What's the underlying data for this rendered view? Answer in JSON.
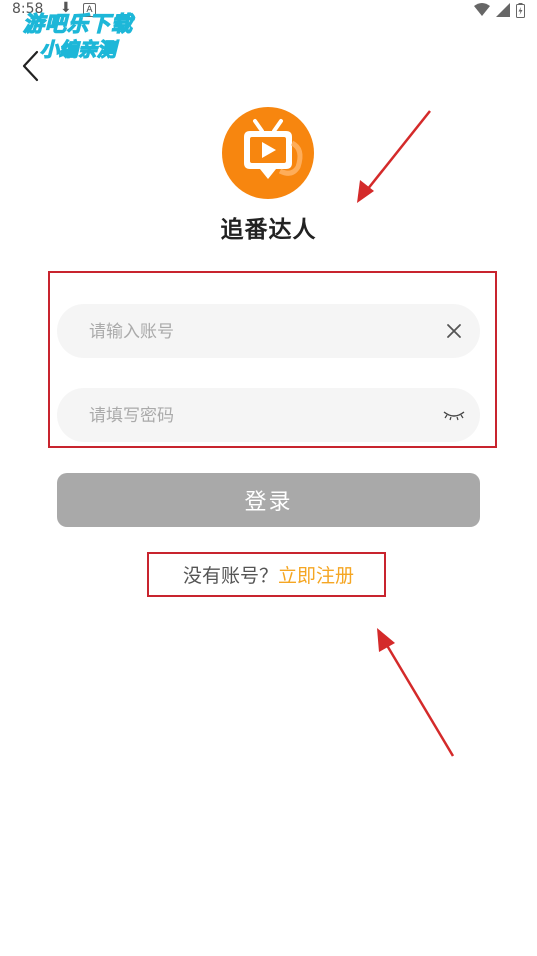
{
  "status_bar": {
    "time": "8:58",
    "download_icon": "download-arrow-icon",
    "a_icon": "A"
  },
  "watermark": {
    "line1": "游吧乐下载",
    "line2": "小编亲测"
  },
  "header": {
    "back_icon": "chevron-left-icon"
  },
  "app": {
    "title": "追番达人",
    "logo_icon": "tv-play-icon",
    "brand_color": "#f7860f"
  },
  "login_form": {
    "account_placeholder": "请输入账号",
    "account_value": "",
    "password_placeholder": "请填写密码",
    "password_value": "",
    "clear_icon": "close-icon",
    "password_toggle_icon": "eye-closed-icon",
    "login_label": "登录",
    "login_button_color": "#a9a9a9"
  },
  "register": {
    "prompt": "没有账号？",
    "link_label": "立即注册",
    "link_color": "#f5a623"
  },
  "annotations": {
    "highlight_color": "#c8242e"
  }
}
